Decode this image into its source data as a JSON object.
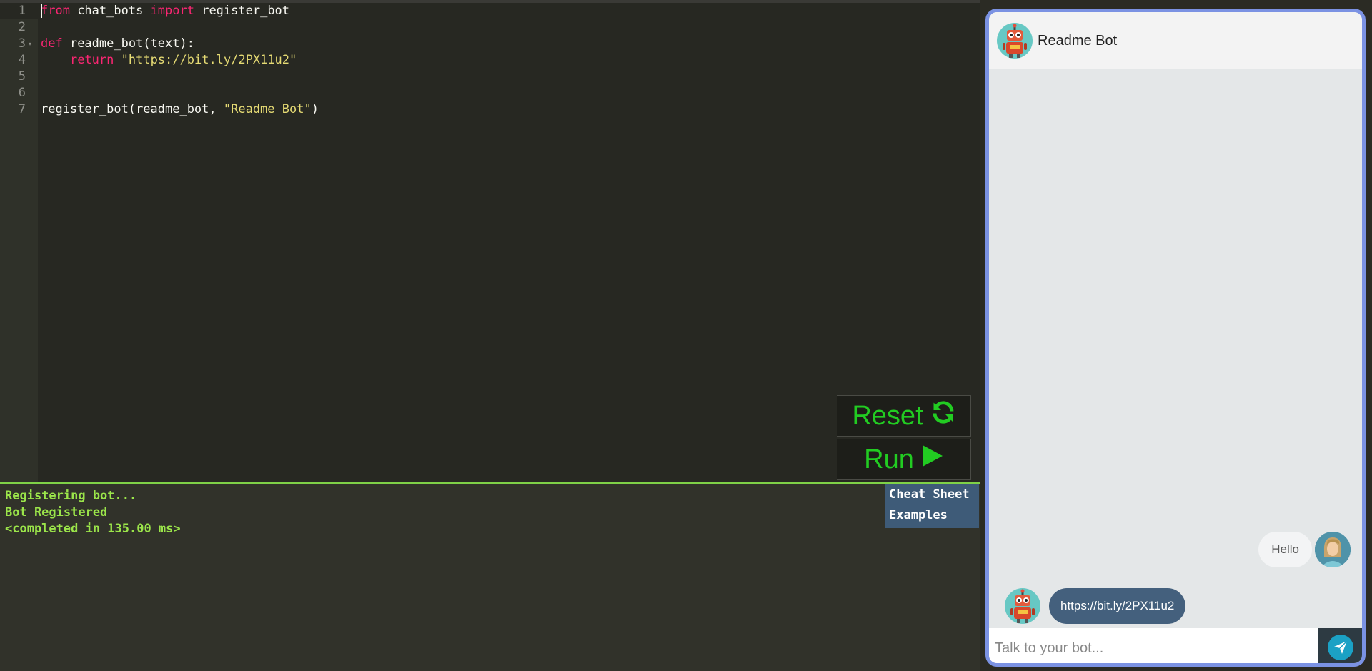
{
  "editor": {
    "line_numbers": [
      "1",
      "2",
      "3",
      "4",
      "5",
      "6",
      "7"
    ],
    "lines": {
      "l1": {
        "kw1": "from",
        "t1": " chat_bots ",
        "kw2": "import",
        "t2": " register_bot"
      },
      "l3": {
        "kw": "def",
        "t": " readme_bot(text):"
      },
      "l4": {
        "indent": "    ",
        "kw": "return",
        "sp": " ",
        "str": "\"https://bit.ly/2PX11u2\""
      },
      "l7": {
        "t1": "register_bot(readme_bot, ",
        "str": "\"Readme Bot\"",
        "t2": ")"
      }
    }
  },
  "buttons": {
    "reset_label": "Reset",
    "run_label": "Run"
  },
  "console": {
    "lines": [
      "Registering bot...",
      "Bot Registered",
      "<completed in 135.00 ms>"
    ],
    "links": {
      "cheat_sheet": "Cheat Sheet",
      "examples": "Examples"
    }
  },
  "chat": {
    "title": "Readme Bot",
    "messages": {
      "user": "Hello",
      "bot": "https://bit.ly/2PX11u2"
    },
    "input_placeholder": "Talk to your bot..."
  },
  "colors": {
    "accent_green": "#22cc22",
    "console_text": "#9be54a",
    "chat_frame": "#7b92e3",
    "bot_bubble": "#44607d",
    "send_button": "#1ba1c5"
  },
  "icons": {
    "reset": "refresh-icon",
    "run": "play-icon",
    "send": "paper-plane-icon",
    "bot_avatar": "robot-icon",
    "user_avatar": "user-icon"
  }
}
